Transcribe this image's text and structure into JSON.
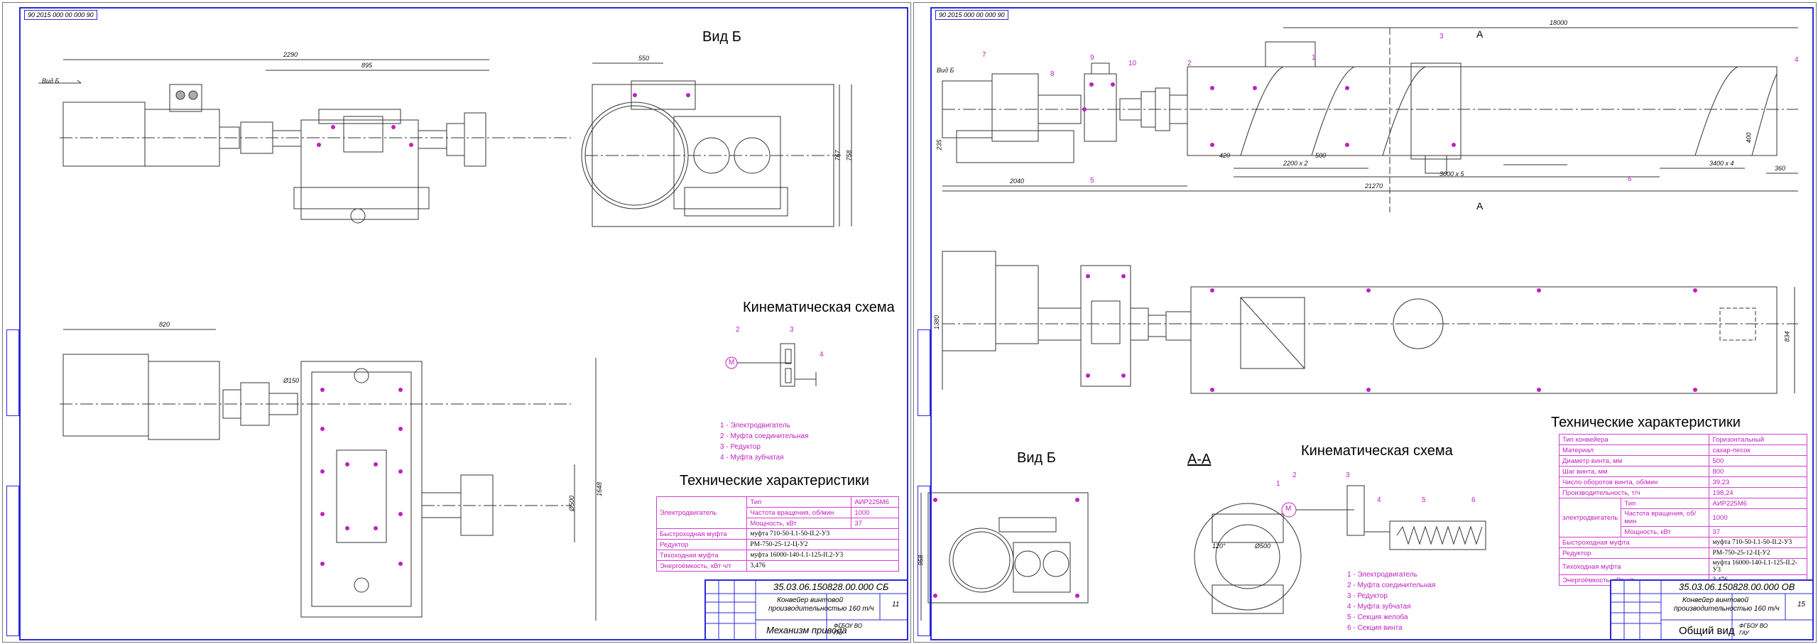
{
  "sheet1": {
    "stamp_code": "90 2015 000 00 000 90",
    "view_b_title": "Вид Б",
    "view_b_arrow": "Вид Б",
    "kinematic_title": "Кинематическая схема",
    "kin_numbers": [
      "2",
      "3",
      "4"
    ],
    "kin_motor": "М",
    "kin_legend": [
      "1 - Электродвигатель",
      "2 - Муфта соединительная",
      "3 - Редуктор",
      "4 - Муфта зубчатая"
    ],
    "spec_title": "Технические характеристики",
    "spec": {
      "motor_label": "Электродвигатель",
      "motor_rows": [
        {
          "k": "Тип",
          "v": "АИР225М6"
        },
        {
          "k": "Частота вращения, об/мин",
          "v": "1000"
        },
        {
          "k": "Мощность, кВт",
          "v": "37"
        }
      ],
      "rows": [
        {
          "k": "Быстроходная муфта",
          "v": "муфта 710-50-I.1-50-II.2-У3"
        },
        {
          "k": "Редуктор",
          "v": "РМ-750-25-12-Ц-У2"
        },
        {
          "k": "Тихоходная муфта",
          "v": "муфта 16000-140-I.1-125-II.2-У3"
        },
        {
          "k": "Энергоёмкость, кВт ч/т",
          "v": "3,476"
        }
      ]
    },
    "dims": [
      "2290",
      "895",
      "550",
      "767",
      "758",
      "820",
      "Ø150",
      "Ø500",
      "1648"
    ],
    "title_block": {
      "code": "35.03.06.150828.00.000 СБ",
      "title": [
        "Конвейер винтовой",
        "производительностью 160 т/ч"
      ],
      "name": "Механизм привода",
      "sheet": "11",
      "org": [
        "ФГБОУ ВО",
        "ГАУ"
      ]
    }
  },
  "sheet2": {
    "stamp_code": "90 2015 000 00 000 90",
    "view_b_title": "Вид Б",
    "section_title": "А-А",
    "section_marks": [
      "А",
      "А"
    ],
    "view_b_arrow": "Вид Б",
    "kinematic_title": "Кинематическая схема",
    "kin_numbers": [
      "1",
      "2",
      "3",
      "4",
      "5",
      "6"
    ],
    "kin_motor": "М",
    "kin_legend": [
      "1 - Электродвигатель",
      "2 - Муфта соединительная",
      "3 - Редуктор",
      "4 - Муфта зубчатая",
      "5 - Секция желоба",
      "6 - Секция винта"
    ],
    "spec_title": "Технические характеристики",
    "spec": {
      "rows_top": [
        {
          "k": "Тип конвейера",
          "v": "Горизонтальный"
        },
        {
          "k": "Материал",
          "v": "сахар-песок"
        },
        {
          "k": "Диаметр винта, мм",
          "v": "500"
        },
        {
          "k": "Шаг винта, мм",
          "v": "800"
        },
        {
          "k": "Число оборотов винта, об/мин",
          "v": "39,23"
        },
        {
          "k": "Производительность, т/ч",
          "v": "198,24"
        }
      ],
      "motor_label": "электродвигатель",
      "motor_rows": [
        {
          "k": "Тип",
          "v": "АИР225М6"
        },
        {
          "k": "Частота вращения, об/мин",
          "v": "1000"
        },
        {
          "k": "Мощность, кВт",
          "v": "37"
        }
      ],
      "rows": [
        {
          "k": "Быстроходная муфта",
          "v": "муфта 710-50-I.1-50-II.2-У3"
        },
        {
          "k": "Редуктор",
          "v": "РМ-750-25-12-Ц-У2"
        },
        {
          "k": "Тихоходная муфта",
          "v": "муфта 16000-140-I.1-125-II.2-У3"
        },
        {
          "k": "Энергоёмкость, кВт ч/т",
          "v": "3,476"
        }
      ]
    },
    "dims": [
      "18000",
      "21270",
      "2040",
      "3000 x 5",
      "2200 x 2",
      "3400 x 4",
      "420",
      "500",
      "360",
      "235",
      "1380",
      "834",
      "958",
      "400",
      "Ø500",
      "120°"
    ],
    "callouts": [
      "1",
      "2",
      "3",
      "4",
      "5",
      "6",
      "7",
      "8",
      "9",
      "10"
    ],
    "title_block": {
      "code": "35.03.06.150828.00.000 ОВ",
      "title": [
        "Конвейер винтовой",
        "производительностью 160 т/ч"
      ],
      "name": "Общий вид",
      "sheet": "15",
      "org": [
        "ФГБОУ ВО",
        "ГАУ"
      ]
    }
  }
}
